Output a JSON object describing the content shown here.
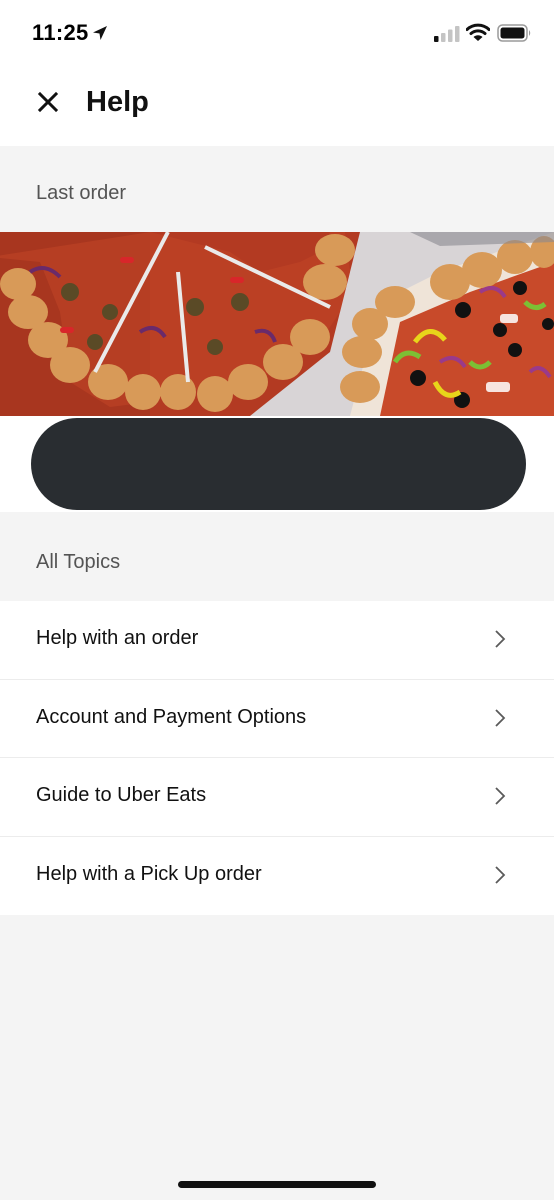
{
  "status_bar": {
    "time": "11:25",
    "icons": [
      "location-arrow-icon",
      "cellular-signal-icon",
      "wifi-icon",
      "battery-icon"
    ]
  },
  "header": {
    "title": "Help",
    "close_icon": "close-icon"
  },
  "last_order": {
    "section_label": "Last order"
  },
  "all_topics": {
    "section_label": "All Topics",
    "items": [
      {
        "label": "Help with an order"
      },
      {
        "label": "Account and Payment Options"
      },
      {
        "label": "Guide to Uber Eats"
      },
      {
        "label": "Help with a Pick Up order"
      }
    ]
  },
  "colors": {
    "background": "#f4f4f4",
    "surface": "#ffffff",
    "redaction": "#292d31",
    "secondary_text": "#545454"
  }
}
